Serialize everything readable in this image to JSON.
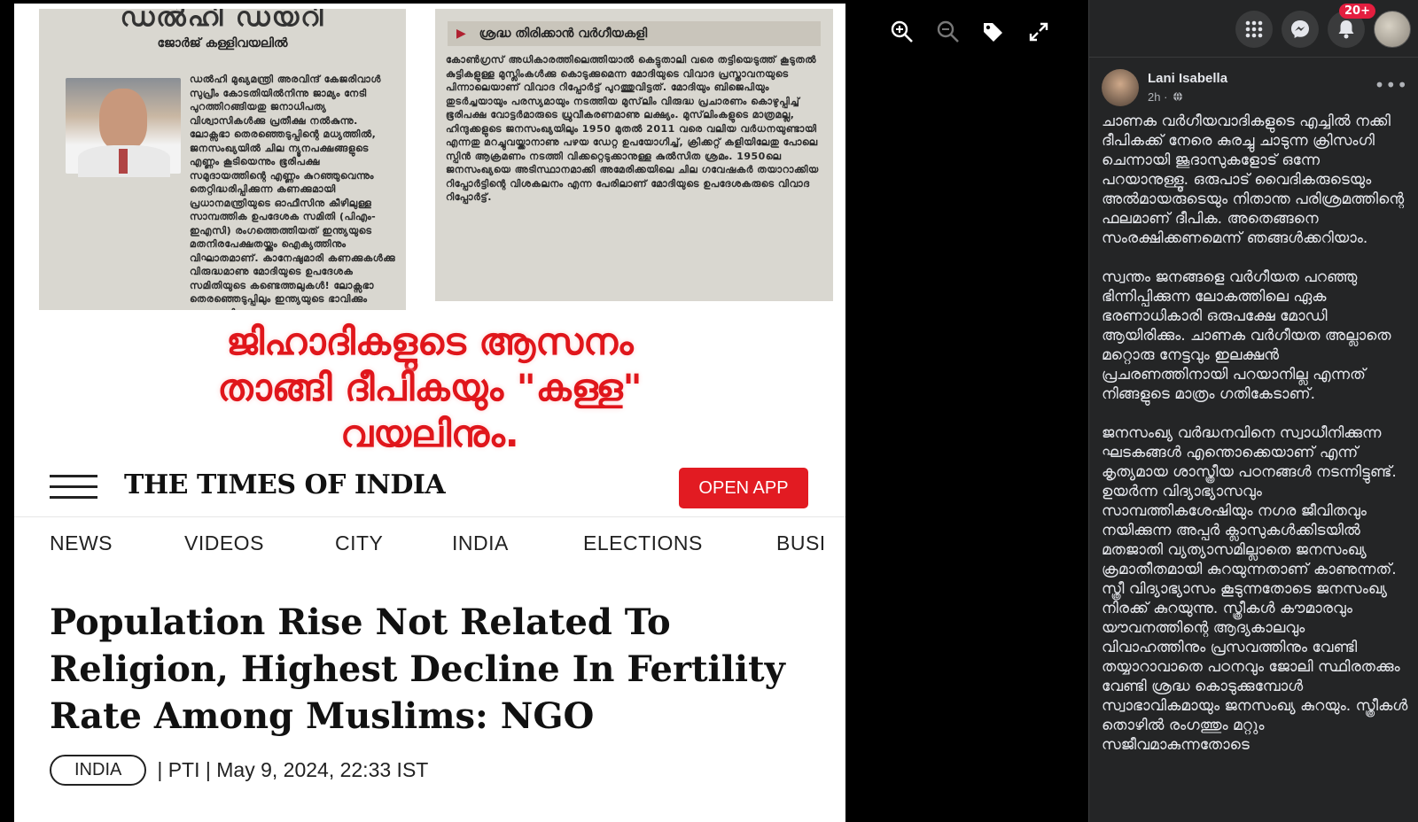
{
  "image": {
    "clipping_left": {
      "masthead": "ഡൽഹി ഡയറി",
      "byline": "ജോർജ് കള്ളിവയലിൽ",
      "body": "ഡൽഹി മുഖ്യമന്ത്രി അരവിന്ദ് കേജരിവാൾ സുപ്രീം കോടതിയിൽനിന്നു ജാമ്യം നേടി പുറത്തിറങ്ങിയതു ജനാധിപത്യ വിശ്വാസികൾക്കു പ്രതീക്ഷ നൽകുന്നു. ലോക്സഭാ തെരഞ്ഞെടുപ്പിന്റെ മധ്യത്തിൽ, ജനസംഖ്യയിൽ ചില ന്യൂനപക്ഷങ്ങളുടെ എണ്ണം കൂടിയെന്നും ഭൂരിപക്ഷ സമുദായത്തിന്റെ എണ്ണം കുറഞ്ഞുവെന്നും തെറ്റിദ്ധരിപ്പിക്കുന്ന കണക്കുമായി പ്രധാനമന്ത്രിയുടെ ഓഫീസിനു കീഴിലുള്ള സാമ്പത്തിക ഉപദേശക സമിതി (പിഎം- ഇഎസി) രംഗത്തെത്തിയത് ഇന്ത്യയുടെ മതനിരപേക്ഷതയ്ക്കും ഐക്യത്തിനും വിഘാതമാണ്. കാനേഷുമാരി കണക്കുകൾക്കു വിരുദ്ധമാണു മോദിയുടെ ഉപദേശക സമിതിയുടെ കണ്ടെത്തലുകൾ! ലോക്സഭാ തെരഞ്ഞെടുപ്പിലും ഇന്ത്യയുടെ ഭാവിക്കും വളരെ നി"
    },
    "clipping_right": {
      "section": "ശ്രദ്ധ തിരിക്കാൻ വർഗീയകളി",
      "body": "കോൺഗ്രസ് അധികാരത്തിലെത്തിയാൽ കെട്ടുതാലി വരെ തട്ടിയെടുത്ത് കൂടുതൽ കുട്ടികളുള്ള മുസ്ലിംകൾക്കു കൊടുക്കുമെന്ന മോദിയുടെ വിവാദ പ്രസ്താവനയുടെ പിന്നാലെയാണ് വിവാദ റിപ്പോർട്ട് പുറത്തുവിട്ടത്. മോദിയും ബിജെപിയും തുടർച്ചയായും പരസ്യമായും നടത്തിയ മുസ്‌ലിം വിരുദ്ധ പ്രചാരണം കൊഴുപ്പിച്ച് ഭൂരിപക്ഷ വോട്ടർമാരുടെ ധ്രുവീകരണമാണു ലക്ഷ്യം. മുസ്‌ലിംകളുടെ മാത്രമല്ല, ഹിന്ദുക്കളുടെ ജനസംഖ്യയിലും 1950 മുതൽ 2011 വരെ വലിയ വർധനയുണ്ടായി എന്നതു മറച്ചുവയ്ക്കാനാണു പഴയ ഡേറ്റ ഉപയോഗിച്ച്, ക്രിക്കറ്റ് കളിയിലേതു പോലെ സ്പിൻ ആക്രമണം നടത്തി വിക്കറ്റെടുക്കാനുള്ള കുൽസിത ശ്രമം. 1950ലെ ജനസംഖ്യയെ അടിസ്ഥാനമാക്കി അമേരിക്കയിലെ ചില ഗവേഷകർ തയാറാക്കിയ റിപ്പോർട്ടിന്റെ വിശകലനം എന്ന പേരിലാണ് മോദിയുടെ ഉപദേശകരുടെ വിവാദ റിപ്പോർട്ട്."
    },
    "overlay_headline": [
      "ജിഹാദികളുടെ ആസനം",
      "താങ്ങി ദീപികയും \"കള്ള\"",
      "വയലിനും."
    ],
    "toi": {
      "logo": "THE TIMES OF INDIA",
      "open_app": "OPEN APP",
      "nav": [
        "NEWS",
        "VIDEOS",
        "CITY",
        "INDIA",
        "ELECTIONS",
        "BUSI"
      ],
      "headline": "Population Rise Not Related To Religion, Highest Decline In Fertility Rate Among Muslims: NGO",
      "badge": "INDIA",
      "meta": "| PTI | May 9, 2024, 22:33 IST"
    }
  },
  "viewer_tools": [
    "zoom-in-icon",
    "zoom-out-icon",
    "tag-icon",
    "fullscreen-icon"
  ],
  "topbar": {
    "notification_count": "20+"
  },
  "post": {
    "author": "Lani Isabella",
    "time": "2h ·",
    "more": "•••",
    "paragraphs": [
      "ചാണക വർഗീയവാദികളുടെ എച്ചിൽ നക്കി ദീപികക്ക് നേരെ കുരച്ചു ചാടുന്ന ക്രിസംഗി ചെന്നായി ജൂദാസുകളോട് ഒന്നേ പറയാനുള്ളൂ. ഒരുപാട് വൈദികരുടെയും അൽമായരുടെയും നിതാന്ത പരിശ്രമത്തിന്റെ ഫലമാണ് ദീപിക. അതെങ്ങനെ സംരക്ഷിക്കണമെന്ന് ഞങ്ങൾക്കറിയാം.",
      "സ്വന്തം ജനങ്ങളെ വർഗീയത പറഞ്ഞു ഭിന്നിപ്പിക്കുന്ന ലോകത്തിലെ ഏക ഭരണാധികാരി ഒരുപക്ഷേ മോഡി ആയിരിക്കും. ചാണക വർഗീയത അല്ലാതെ മറ്റൊരു നേട്ടവും ഇലക്ഷൻ പ്രചരണത്തിനായി പറയാനില്ല എന്നത് നിങ്ങളുടെ മാത്രം ഗതികേടാണ്.",
      "ജനസംഖ്യ വർദ്ധനവിനെ സ്വാധീനിക്കുന്ന ഘടകങ്ങൾ എന്തൊക്കെയാണ് എന്ന് കൃത്യമായ ശാസ്ത്രീയ പഠനങ്ങൾ നടന്നിട്ടുണ്ട്. ഉയർന്ന വിദ്യാഭ്യാസവും സാമ്പത്തികശേഷിയും നഗര ജീവിതവും നയിക്കുന്ന അപ്പർ ക്ലാസുകൾക്കിടയിൽ മതജാതി വ്യത്യാസമില്ലാതെ ജനസംഖ്യ ക്രമാതീതമായി കുറയുന്നതാണ് കാണുന്നത്. സ്ത്രീ വിദ്യാഭ്യാസം കൂടുന്നതോടെ ജനസംഖ്യ നിരക്ക് കുറയുന്നു. സ്ത്രീകൾ കൗമാരവും യൗവനത്തിന്റെ ആദ്യകാലവും വിവാഹത്തിനും പ്രസവത്തിനും വേണ്ടി തയ്യാറാവാതെ പഠനവും ജോലി സ്ഥിരതക്കും വേണ്ടി ശ്രദ്ധ കൊടുക്കുമ്പോൾ സ്വാഭാവികമായും ജനസംഖ്യ കുറയും. സ്ത്രീകൾ തൊഴിൽ രംഗത്തും മറ്റും സജീവമാകുന്നതോടെ"
    ]
  },
  "colors": {
    "panel_bg": "#242526",
    "text_primary": "#e4e6eb",
    "text_secondary": "#b0b3b8",
    "headline_red": "#e0161b",
    "toi_red": "#e21b22",
    "badge_red": "#e41e3f"
  }
}
